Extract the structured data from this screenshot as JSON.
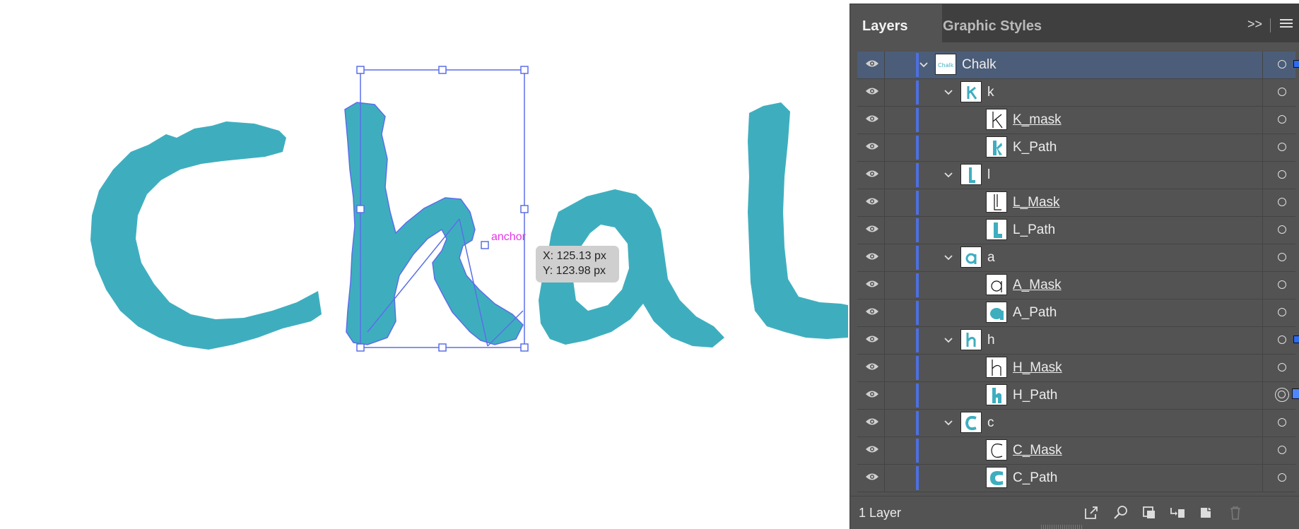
{
  "canvas": {
    "tooltip_x": "X: 125.13 px",
    "tooltip_y": "Y: 123.98 px",
    "anchor_label": "anchor",
    "artwork_color": "#3eaebf",
    "selection_color": "#5b6ee8"
  },
  "panel": {
    "tabs": [
      {
        "label": "Layers",
        "active": true
      },
      {
        "label": "Graphic Styles",
        "active": false
      }
    ],
    "collapse_label": ">>",
    "rows": [
      {
        "name": "Chalk",
        "level": 0,
        "expanded": true,
        "thumb": "chalk-word",
        "underline": false,
        "selected": true,
        "target": "single",
        "sel_indicator": "small"
      },
      {
        "name": "k",
        "level": 1,
        "expanded": true,
        "thumb": "letter-k",
        "underline": false,
        "selected": false,
        "target": "single",
        "sel_indicator": "none"
      },
      {
        "name": "K_mask",
        "level": 2,
        "expanded": false,
        "thumb": "mask-k",
        "underline": true,
        "selected": false,
        "target": "single",
        "sel_indicator": "none"
      },
      {
        "name": "K_Path",
        "level": 2,
        "expanded": false,
        "thumb": "path-k",
        "underline": false,
        "selected": false,
        "target": "single",
        "sel_indicator": "none"
      },
      {
        "name": "l",
        "level": 1,
        "expanded": true,
        "thumb": "letter-l",
        "underline": false,
        "selected": false,
        "target": "single",
        "sel_indicator": "none"
      },
      {
        "name": "L_Mask",
        "level": 2,
        "expanded": false,
        "thumb": "mask-l",
        "underline": true,
        "selected": false,
        "target": "single",
        "sel_indicator": "none"
      },
      {
        "name": "L_Path",
        "level": 2,
        "expanded": false,
        "thumb": "path-l",
        "underline": false,
        "selected": false,
        "target": "single",
        "sel_indicator": "none"
      },
      {
        "name": "a",
        "level": 1,
        "expanded": true,
        "thumb": "letter-a",
        "underline": false,
        "selected": false,
        "target": "single",
        "sel_indicator": "none"
      },
      {
        "name": "A_Mask",
        "level": 2,
        "expanded": false,
        "thumb": "mask-a",
        "underline": true,
        "selected": false,
        "target": "single",
        "sel_indicator": "none"
      },
      {
        "name": "A_Path",
        "level": 2,
        "expanded": false,
        "thumb": "path-a",
        "underline": false,
        "selected": false,
        "target": "single",
        "sel_indicator": "none"
      },
      {
        "name": "h",
        "level": 1,
        "expanded": true,
        "thumb": "letter-h",
        "underline": false,
        "selected": false,
        "target": "single",
        "sel_indicator": "small"
      },
      {
        "name": "H_Mask",
        "level": 2,
        "expanded": false,
        "thumb": "mask-h",
        "underline": true,
        "selected": false,
        "target": "single",
        "sel_indicator": "none"
      },
      {
        "name": "H_Path",
        "level": 2,
        "expanded": false,
        "thumb": "path-h",
        "underline": false,
        "selected": false,
        "target": "double",
        "sel_indicator": "big"
      },
      {
        "name": "c",
        "level": 1,
        "expanded": true,
        "thumb": "letter-c",
        "underline": false,
        "selected": false,
        "target": "single",
        "sel_indicator": "none"
      },
      {
        "name": "C_Mask",
        "level": 2,
        "expanded": false,
        "thumb": "mask-c",
        "underline": true,
        "selected": false,
        "target": "single",
        "sel_indicator": "none"
      },
      {
        "name": "C_Path",
        "level": 2,
        "expanded": false,
        "thumb": "path-c",
        "underline": false,
        "selected": false,
        "target": "single",
        "sel_indicator": "none"
      }
    ],
    "footer": {
      "layer_count": "1 Layer",
      "icons": [
        "export-icon",
        "locate-object-icon",
        "make-clipping-mask-icon",
        "new-sublayer-icon",
        "new-layer-icon",
        "delete-icon"
      ]
    }
  }
}
